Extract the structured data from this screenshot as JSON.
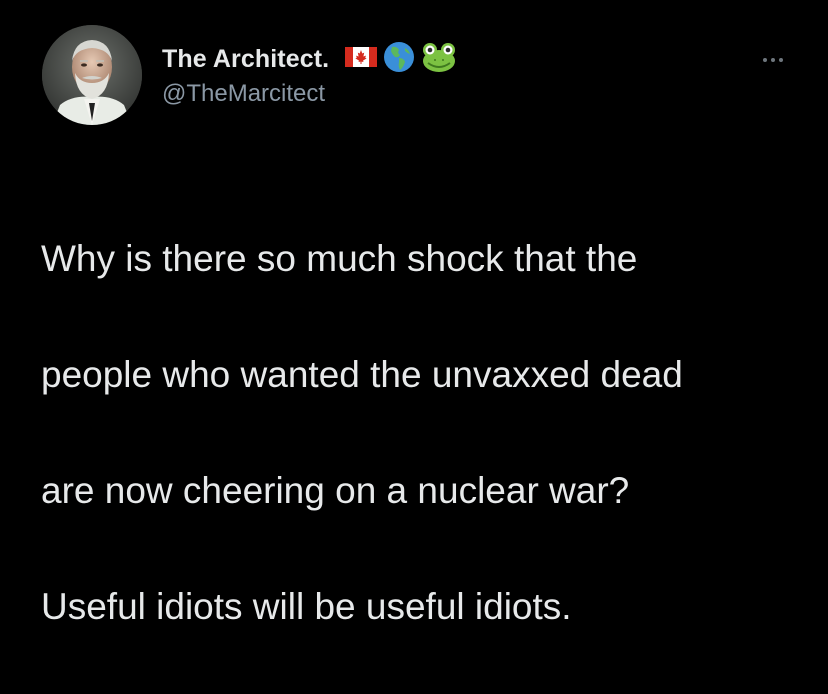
{
  "author": {
    "display_name": "The Architect.",
    "handle": "@TheMarcitect",
    "badges": [
      "canada-flag-icon",
      "globe-americas-icon",
      "frog-icon"
    ]
  },
  "tweet": {
    "lines": [
      "Why is there so much shock that the",
      "people who wanted the unvaxxed dead",
      "are now cheering on a nuclear war?",
      "Useful idiots will be useful idiots."
    ]
  },
  "colors": {
    "background": "#000000",
    "text": "#e7e9ea",
    "secondary_text": "#8b98a5"
  }
}
